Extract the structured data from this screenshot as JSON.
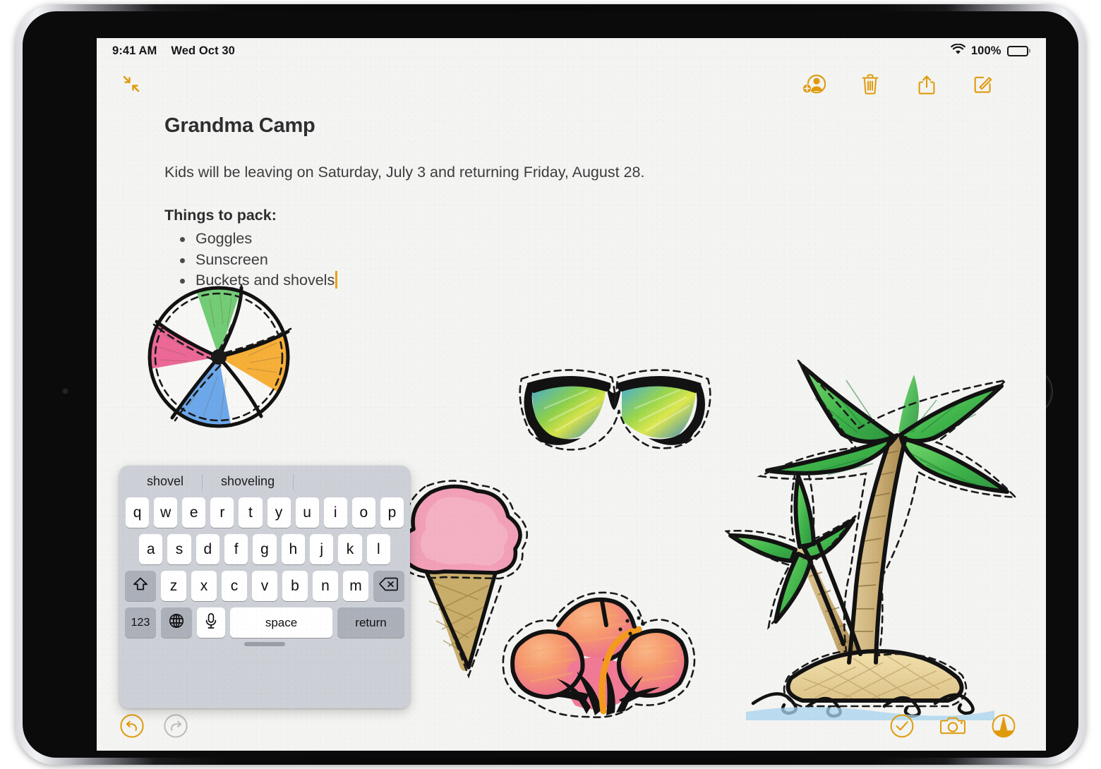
{
  "device": {
    "name": "iPad",
    "accent_color": "#e09b0c",
    "screen_background": "#f4f4f2"
  },
  "status_bar": {
    "time": "9:41 AM",
    "date": "Wed Oct 30",
    "battery_percent": "100%",
    "wifi_icon": "wifi-icon",
    "battery_icon": "battery-full-icon"
  },
  "top_toolbar": {
    "collapse": {
      "label": "Collapse",
      "icon": "collapse-arrows-icon"
    },
    "collaborate": {
      "label": "Add People",
      "icon": "add-person-icon"
    },
    "trash": {
      "label": "Delete",
      "icon": "trash-icon"
    },
    "share": {
      "label": "Share",
      "icon": "share-icon"
    },
    "compose": {
      "label": "New Note",
      "icon": "compose-icon"
    }
  },
  "note": {
    "title": "Grandma Camp",
    "paragraph": "Kids will be leaving on Saturday, July 3 and returning Friday, August 28.",
    "list_heading": "Things to pack:",
    "items": [
      "Goggles",
      "Sunscreen",
      "Buckets and shovels"
    ],
    "caret_after_item_index": 2
  },
  "stickers": [
    {
      "name": "beach-ball-sticker",
      "colors": [
        "#5cc45f",
        "#e8447f",
        "#4a93e8",
        "#f5a623"
      ]
    },
    {
      "name": "ice-cream-cone-sticker",
      "colors": [
        "#f2a0b8",
        "#c9ad6a"
      ]
    },
    {
      "name": "sunglasses-sticker",
      "colors": [
        "#1b1b1b",
        "#3fa9e0",
        "#8dd04a"
      ]
    },
    {
      "name": "hibiscus-flower-sticker",
      "colors": [
        "#f07a95",
        "#f59a4e",
        "#f5a623"
      ]
    },
    {
      "name": "palm-tree-island-sticker",
      "colors": [
        "#4cbf52",
        "#d6bb86",
        "#9cc9e8"
      ]
    }
  ],
  "keyboard": {
    "type": "floating-keyboard",
    "predictions": [
      "shovel",
      "shoveling"
    ],
    "rows": {
      "row1": [
        "q",
        "w",
        "e",
        "r",
        "t",
        "y",
        "u",
        "i",
        "o",
        "p"
      ],
      "row2": [
        "a",
        "s",
        "d",
        "f",
        "g",
        "h",
        "j",
        "k",
        "l"
      ],
      "row3": [
        "z",
        "x",
        "c",
        "v",
        "b",
        "n",
        "m"
      ]
    },
    "shift_key": {
      "label": "",
      "icon": "shift-arrow-icon"
    },
    "delete_key": {
      "label": "",
      "icon": "backspace-icon"
    },
    "numbers_key": {
      "label": "123"
    },
    "globe_key": {
      "label": "",
      "icon": "globe-icon"
    },
    "mic_key": {
      "label": "",
      "icon": "microphone-icon"
    },
    "space_key": {
      "label": "space"
    },
    "return_key": {
      "label": "return"
    },
    "handle": {
      "name": "keyboard-drag-handle"
    }
  },
  "bottom_toolbar": {
    "undo": {
      "label": "Undo",
      "icon": "undo-icon",
      "enabled": true,
      "color": "#e09b0c"
    },
    "redo": {
      "label": "Redo",
      "icon": "redo-icon",
      "enabled": false,
      "color": "#b9b9bb"
    },
    "done": {
      "label": "Done",
      "icon": "checkmark-circle-icon"
    },
    "camera": {
      "label": "Camera",
      "icon": "camera-icon"
    },
    "markup": {
      "label": "Markup",
      "icon": "markup-pen-icon"
    }
  }
}
